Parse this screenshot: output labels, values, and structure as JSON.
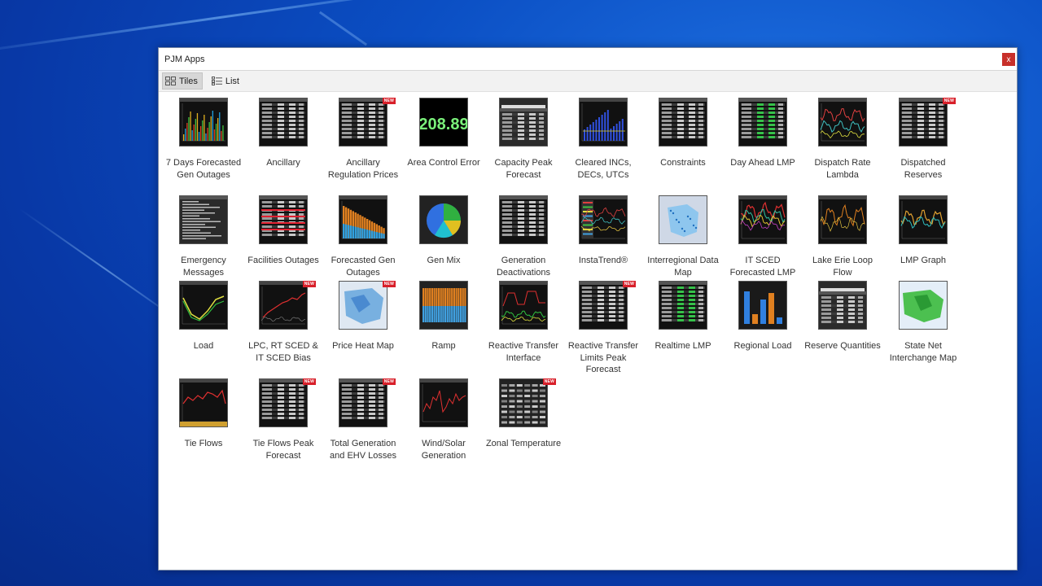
{
  "window": {
    "title": "PJM Apps",
    "close_label": "x"
  },
  "toolbar": {
    "tiles_label": "Tiles",
    "list_label": "List"
  },
  "tiles": [
    {
      "label": "7 Days Forecasted Gen Outages",
      "thumb": "bars-multi",
      "new": false
    },
    {
      "label": "Ancillary",
      "thumb": "table",
      "new": false
    },
    {
      "label": "Ancillary Regulation Prices",
      "thumb": "table",
      "new": true
    },
    {
      "label": "Area Control Error",
      "thumb": "bignum",
      "value": "208.89",
      "new": false
    },
    {
      "label": "Capacity Peak Forecast",
      "thumb": "table-light",
      "new": false
    },
    {
      "label": "Cleared INCs, DECs, UTCs",
      "thumb": "bars-blue",
      "new": false
    },
    {
      "label": "Constraints",
      "thumb": "table",
      "new": false
    },
    {
      "label": "Day Ahead LMP",
      "thumb": "table-green",
      "new": false
    },
    {
      "label": "Dispatch Rate Lambda",
      "thumb": "lines-red",
      "new": false
    },
    {
      "label": "Dispatched Reserves",
      "thumb": "table",
      "new": true
    },
    {
      "label": "Emergency Messages",
      "thumb": "text",
      "new": false
    },
    {
      "label": "Facilities Outages",
      "thumb": "table-red",
      "new": false
    },
    {
      "label": "Forecasted Gen Outages",
      "thumb": "bars-orange",
      "new": false
    },
    {
      "label": "Gen Mix",
      "thumb": "pie",
      "new": false
    },
    {
      "label": "Generation Deactivations",
      "thumb": "table",
      "new": false
    },
    {
      "label": "InstaTrend®",
      "thumb": "trend",
      "new": false
    },
    {
      "label": "Interregional Data Map",
      "thumb": "map-light",
      "new": false
    },
    {
      "label": "IT SCED Forecasted LMP",
      "thumb": "lines-multi",
      "new": false
    },
    {
      "label": "Lake Erie Loop Flow",
      "thumb": "lines-orange",
      "new": false
    },
    {
      "label": "LMP Graph",
      "thumb": "lines-orange2",
      "new": false
    },
    {
      "label": "Load",
      "thumb": "load",
      "new": false
    },
    {
      "label": "LPC, RT SCED & IT SCED Bias",
      "thumb": "lines-red2",
      "new": true
    },
    {
      "label": "Price Heat Map",
      "thumb": "map-blue",
      "new": true
    },
    {
      "label": "Ramp",
      "thumb": "ramp",
      "new": false
    },
    {
      "label": "Reactive Transfer Interface",
      "thumb": "lines-multi2",
      "new": false
    },
    {
      "label": "Reactive Transfer Limits Peak Forecast",
      "thumb": "table",
      "new": true
    },
    {
      "label": "Realtime LMP",
      "thumb": "table-green",
      "new": false
    },
    {
      "label": "Regional Load",
      "thumb": "bars-reg",
      "new": false
    },
    {
      "label": "Reserve Quantities",
      "thumb": "table-light",
      "new": false
    },
    {
      "label": "State Net Interchange Map",
      "thumb": "map-green",
      "new": false
    },
    {
      "label": "Tie Flows",
      "thumb": "lines-red3",
      "new": false
    },
    {
      "label": "Tie Flows Peak Forecast",
      "thumb": "table",
      "new": true
    },
    {
      "label": "Total Generation and EHV Losses",
      "thumb": "table",
      "new": true
    },
    {
      "label": "Wind/Solar Generation",
      "thumb": "lines-red4",
      "new": false
    },
    {
      "label": "Zonal Temperature",
      "thumb": "table-white",
      "new": true
    }
  ]
}
